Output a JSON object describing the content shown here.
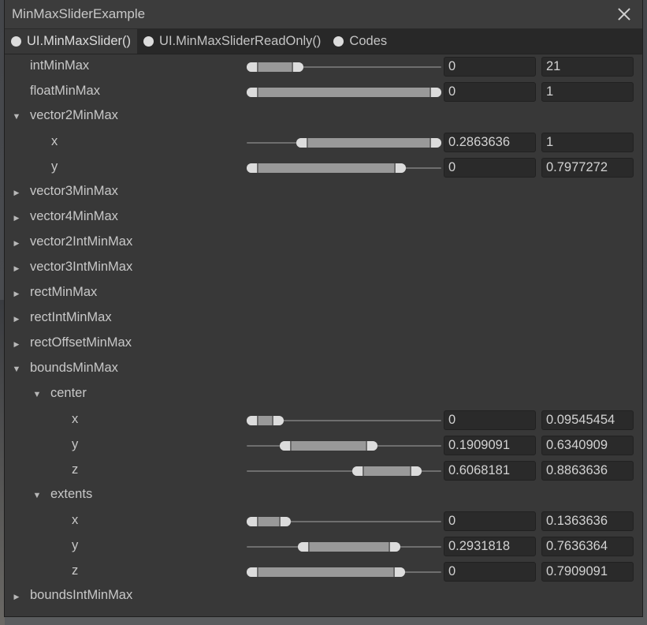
{
  "window": {
    "title": "MinMaxSliderExample"
  },
  "tabs": [
    {
      "label": "UI.MinMaxSlider()",
      "active": true
    },
    {
      "label": "UI.MinMaxSliderReadOnly()",
      "active": false
    },
    {
      "label": "Codes",
      "active": false
    }
  ],
  "rows": [
    {
      "name": "intMinMax",
      "label": "intMinMax",
      "level": 0,
      "arrow": "",
      "slider": {
        "min": 0,
        "max": 21,
        "limitMin": 0,
        "limitMax": 100
      },
      "minValue": "0",
      "maxValue": "21"
    },
    {
      "name": "floatMinMax",
      "label": "floatMinMax",
      "level": 0,
      "arrow": "",
      "slider": {
        "min": 0,
        "max": 1,
        "limitMin": 0,
        "limitMax": 1
      },
      "minValue": "0",
      "maxValue": "1"
    },
    {
      "name": "vector2MinMax",
      "label": "vector2MinMax",
      "level": 0,
      "arrow": "expanded"
    },
    {
      "name": "vector2-x",
      "label": "x",
      "level": 1,
      "arrow": "",
      "slider": {
        "min": 0.2863636,
        "max": 1,
        "limitMin": 0,
        "limitMax": 1
      },
      "minValue": "0.2863636",
      "maxValue": "1"
    },
    {
      "name": "vector2-y",
      "label": "y",
      "level": 1,
      "arrow": "",
      "slider": {
        "min": 0,
        "max": 0.7977272,
        "limitMin": 0,
        "limitMax": 1
      },
      "minValue": "0",
      "maxValue": "0.7977272"
    },
    {
      "name": "vector3MinMax",
      "label": "vector3MinMax",
      "level": 0,
      "arrow": "collapsed"
    },
    {
      "name": "vector4MinMax",
      "label": "vector4MinMax",
      "level": 0,
      "arrow": "collapsed"
    },
    {
      "name": "vector2IntMinMax",
      "label": "vector2IntMinMax",
      "level": 0,
      "arrow": "collapsed"
    },
    {
      "name": "vector3IntMinMax",
      "label": "vector3IntMinMax",
      "level": 0,
      "arrow": "collapsed"
    },
    {
      "name": "rectMinMax",
      "label": "rectMinMax",
      "level": 0,
      "arrow": "collapsed"
    },
    {
      "name": "rectIntMinMax",
      "label": "rectIntMinMax",
      "level": 0,
      "arrow": "collapsed"
    },
    {
      "name": "rectOffsetMinMax",
      "label": "rectOffsetMinMax",
      "level": 0,
      "arrow": "collapsed"
    },
    {
      "name": "boundsMinMax",
      "label": "boundsMinMax",
      "level": 0,
      "arrow": "expanded"
    },
    {
      "name": "center",
      "label": "center",
      "level": 1,
      "arrow": "expanded"
    },
    {
      "name": "center-x",
      "label": "x",
      "level": 2,
      "arrow": "",
      "slider": {
        "min": 0,
        "max": 0.09545454,
        "limitMin": 0,
        "limitMax": 1
      },
      "minValue": "0",
      "maxValue": "0.09545454"
    },
    {
      "name": "center-y",
      "label": "y",
      "level": 2,
      "arrow": "",
      "slider": {
        "min": 0.1909091,
        "max": 0.6340909,
        "limitMin": 0,
        "limitMax": 1
      },
      "minValue": "0.1909091",
      "maxValue": "0.6340909"
    },
    {
      "name": "center-z",
      "label": "z",
      "level": 2,
      "arrow": "",
      "slider": {
        "min": 0.6068181,
        "max": 0.8863636,
        "limitMin": 0,
        "limitMax": 1
      },
      "minValue": "0.6068181",
      "maxValue": "0.8863636"
    },
    {
      "name": "extents",
      "label": "extents",
      "level": 1,
      "arrow": "expanded"
    },
    {
      "name": "extents-x",
      "label": "x",
      "level": 2,
      "arrow": "",
      "slider": {
        "min": 0,
        "max": 0.1363636,
        "limitMin": 0,
        "limitMax": 1
      },
      "minValue": "0",
      "maxValue": "0.1363636"
    },
    {
      "name": "extents-y",
      "label": "y",
      "level": 2,
      "arrow": "",
      "slider": {
        "min": 0.2931818,
        "max": 0.7636364,
        "limitMin": 0,
        "limitMax": 1
      },
      "minValue": "0.2931818",
      "maxValue": "0.7636364"
    },
    {
      "name": "extents-z",
      "label": "z",
      "level": 2,
      "arrow": "",
      "slider": {
        "min": 0,
        "max": 0.7909091,
        "limitMin": 0,
        "limitMax": 1
      },
      "minValue": "0",
      "maxValue": "0.7909091"
    },
    {
      "name": "boundsIntMinMax",
      "label": "boundsIntMinMax",
      "level": 0,
      "arrow": "collapsed"
    }
  ]
}
